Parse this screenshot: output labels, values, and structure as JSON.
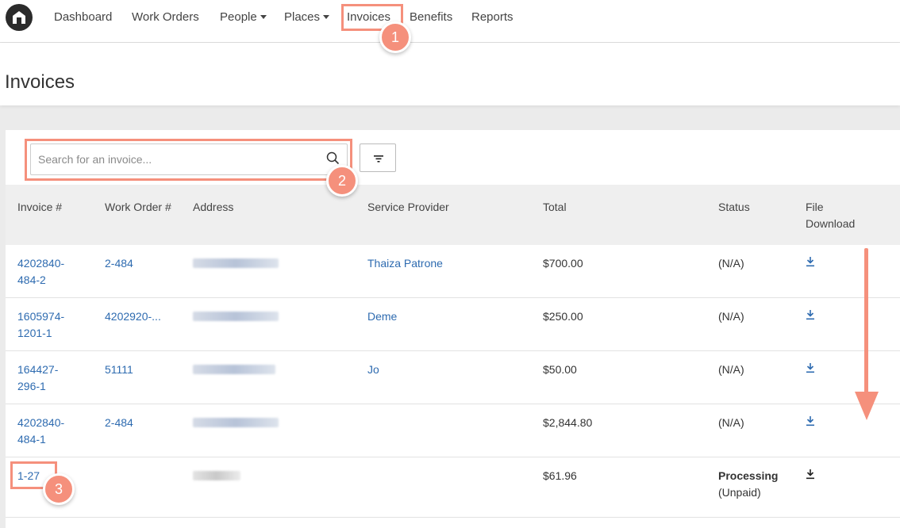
{
  "nav": {
    "items": [
      {
        "label": "Dashboard"
      },
      {
        "label": "Work Orders"
      },
      {
        "label": "People"
      },
      {
        "label": "Places"
      },
      {
        "label": "Invoices"
      },
      {
        "label": "Benefits"
      },
      {
        "label": "Reports"
      }
    ]
  },
  "page": {
    "title": "Invoices"
  },
  "search": {
    "placeholder": "Search for an invoice...",
    "value": ""
  },
  "table": {
    "columns": [
      "Invoice #",
      "Work Order #",
      "Address",
      "Service Provider",
      "Total",
      "Status",
      "File Download"
    ],
    "rows": [
      {
        "invoice": "4202840-484-2",
        "invoice_l1": "4202840-",
        "invoice_l2": "484-2",
        "work_order": "2-484",
        "address_visible": "111 Bat... Ave",
        "provider": "Thaiza Patrone",
        "total": "$700.00",
        "status": "(N/A)"
      },
      {
        "invoice": "1605974-1201-1",
        "invoice_l1": "1605974-",
        "invoice_l2": "1201-1",
        "work_order": "4202920-...",
        "address_visible": "111 Bat... Ave",
        "provider": "Deme",
        "total": "$250.00",
        "status": "(N/A)"
      },
      {
        "invoice": "164427-296-1",
        "invoice_l1": "164427-",
        "invoice_l2": "296-1",
        "work_order": "51111",
        "address_visible": "2011 ... Rd",
        "provider": "Jo",
        "total": "$50.00",
        "status": "(N/A)"
      },
      {
        "invoice": "4202840-484-1",
        "invoice_l1": "4202840-",
        "invoice_l2": "484-1",
        "work_order": "2-484",
        "address_visible": "111 Bat... Ave",
        "provider": "",
        "total": "$2,844.80",
        "status": "(N/A)"
      },
      {
        "invoice": "1-27",
        "invoice_l1": "1-27",
        "invoice_l2": "",
        "work_order": "",
        "address_visible": "...",
        "provider": "",
        "total": "$61.96",
        "status": "Processing",
        "status_sub": "(Unpaid)"
      }
    ]
  },
  "annotations": {
    "step1": "1",
    "step2": "2",
    "step3": "3"
  },
  "colors": {
    "accent": "#f5907c",
    "link": "#2e6bb0",
    "header_bg": "#efefef"
  },
  "icons": {
    "logo": "home-logo-icon",
    "search": "search-icon",
    "filter": "filter-icon",
    "download": "download-icon"
  }
}
